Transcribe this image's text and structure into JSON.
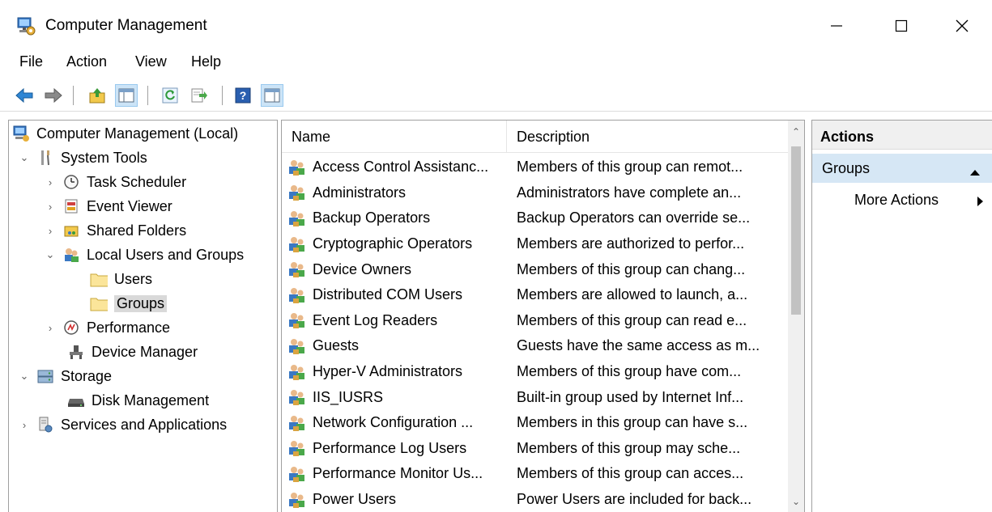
{
  "window": {
    "title": "Computer Management",
    "icon": "computer-management-icon",
    "controls": {
      "minimize": "minimize-icon",
      "maximize": "maximize-icon",
      "close": "close-icon"
    }
  },
  "menu": [
    "File",
    "Action",
    "View",
    "Help"
  ],
  "toolbar": {
    "buttons": [
      "back-arrow-icon",
      "forward-arrow-icon",
      "up-folder-icon",
      "show-hide-tree-icon",
      "refresh-icon",
      "export-list-icon",
      "help-icon",
      "show-hide-action-pane-icon"
    ]
  },
  "tree": {
    "root": "Computer Management (Local)",
    "system_tools": "System Tools",
    "task_scheduler": "Task Scheduler",
    "event_viewer": "Event Viewer",
    "shared_folders": "Shared Folders",
    "local_users_groups": "Local Users and Groups",
    "users": "Users",
    "groups": "Groups",
    "performance": "Performance",
    "device_manager": "Device Manager",
    "storage": "Storage",
    "disk_management": "Disk Management",
    "services_apps": "Services and Applications"
  },
  "list": {
    "columns": {
      "name": "Name",
      "description": "Description"
    },
    "rows": [
      {
        "name": "Access Control Assistanc...",
        "description": "Members of this group can remot..."
      },
      {
        "name": "Administrators",
        "description": "Administrators have complete an..."
      },
      {
        "name": "Backup Operators",
        "description": "Backup Operators can override se..."
      },
      {
        "name": "Cryptographic Operators",
        "description": "Members are authorized to perfor..."
      },
      {
        "name": "Device Owners",
        "description": "Members of this group can chang..."
      },
      {
        "name": "Distributed COM Users",
        "description": "Members are allowed to launch, a..."
      },
      {
        "name": "Event Log Readers",
        "description": "Members of this group can read e..."
      },
      {
        "name": "Guests",
        "description": "Guests have the same access as m..."
      },
      {
        "name": "Hyper-V Administrators",
        "description": "Members of this group have com..."
      },
      {
        "name": "IIS_IUSRS",
        "description": "Built-in group used by Internet Inf..."
      },
      {
        "name": "Network Configuration ...",
        "description": "Members in this group can have s..."
      },
      {
        "name": "Performance Log Users",
        "description": "Members of this group may sche..."
      },
      {
        "name": "Performance Monitor Us...",
        "description": "Members of this group can acces..."
      },
      {
        "name": "Power Users",
        "description": "Power Users are included for back..."
      }
    ]
  },
  "actions": {
    "header": "Actions",
    "group": "Groups",
    "more": "More Actions"
  }
}
